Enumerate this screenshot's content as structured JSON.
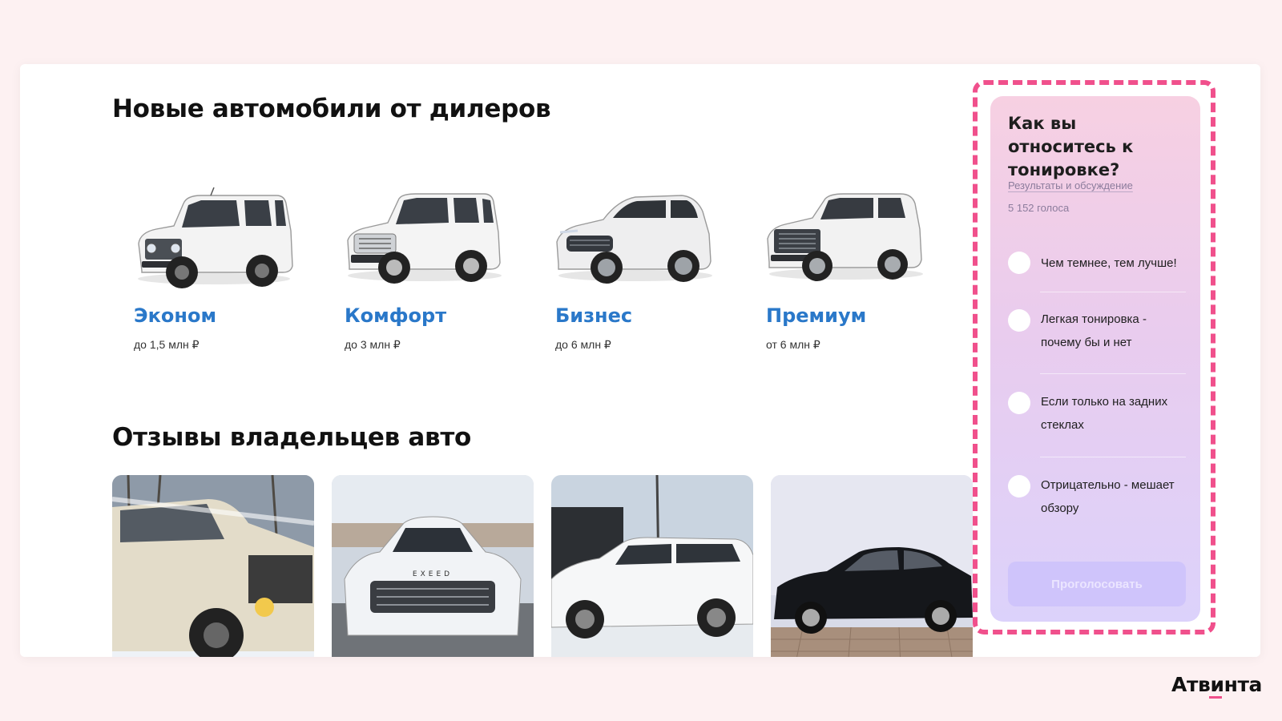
{
  "sections": {
    "new_cars_title": "Новые автомобили от дилеров",
    "reviews_title": "Отзывы владельцев авто"
  },
  "categories": [
    {
      "name": "Эконом",
      "price": "до 1,5 млн ₽"
    },
    {
      "name": "Комфорт",
      "price": "до 3 млн ₽"
    },
    {
      "name": "Бизнес",
      "price": "до 6 млн ₽"
    },
    {
      "name": "Премиум",
      "price": "от 6 млн ₽"
    }
  ],
  "poll": {
    "question": "Как вы относитесь к тонировке?",
    "results_link": "Результаты и обсуждение",
    "votes": "5 152 голоса",
    "options": [
      "Чем темнее, тем лучше!",
      "Легкая тонировка - почему бы и нет",
      "Если только на задних стеклах",
      "Отрицательно - мешает обзору"
    ],
    "vote_button": "Проголосовать"
  },
  "brand": {
    "logo": "Атвинта"
  },
  "colors": {
    "accent": "#f0508c",
    "link": "#2a78c9",
    "button": "#cfc4fb"
  }
}
